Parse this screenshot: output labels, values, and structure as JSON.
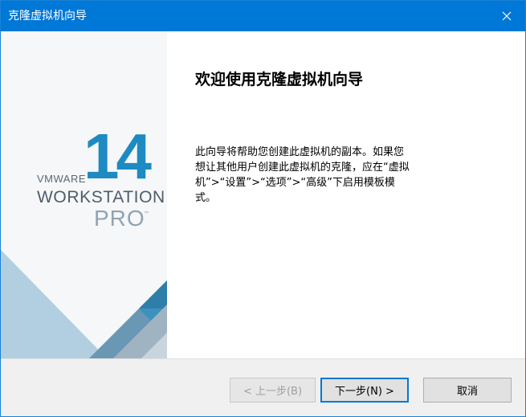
{
  "window": {
    "title": "克隆虚拟机向导",
    "close_icon": "close-icon"
  },
  "branding": {
    "vmware": "VMWARE",
    "version": "14",
    "product": "WORKSTATION",
    "edition": "PRO",
    "trademark": "™",
    "colors": {
      "accent": "#1e8ac2",
      "triangle_light": "#a9c9dc",
      "triangle_dark": "#2d7ea8"
    }
  },
  "content": {
    "heading": "欢迎使用克隆虚拟机向导",
    "description": "此向导将帮助您创建此虚拟机的副本。如果您想让其他用户创建此虚拟机的克隆，应在“虚拟机”>“设置”>“选项”>“高级”下启用模板模式。"
  },
  "buttons": {
    "back": "< 上一步(B)",
    "next": "下一步(N) >",
    "cancel": "取消"
  },
  "colors": {
    "titlebar": "#0078d7",
    "focus_border": "#0078d7"
  }
}
